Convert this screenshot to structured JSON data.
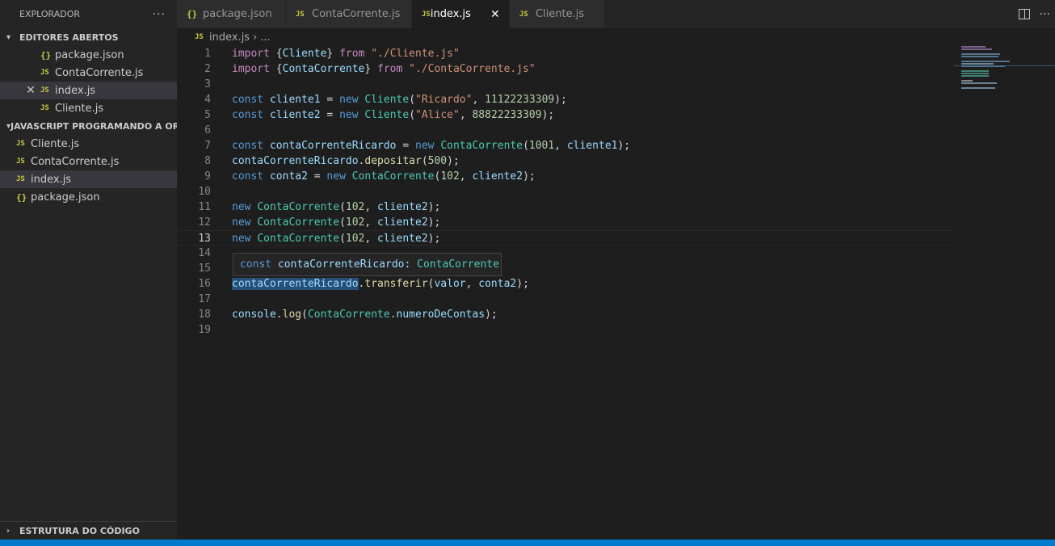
{
  "sidebar": {
    "title": "EXPLORADOR",
    "more": "···",
    "open_editors_title": "EDITORES ABERTOS",
    "open_editors": [
      {
        "icon": "{}",
        "label": "package.json"
      },
      {
        "icon": "JS",
        "label": "ContaCorrente.js"
      },
      {
        "icon": "JS",
        "label": "index.js",
        "close": "✕"
      },
      {
        "icon": "JS",
        "label": "Cliente.js"
      }
    ],
    "project_title": "JAVASCRIPT PROGRAMANDO A OR...",
    "files": [
      {
        "icon": "JS",
        "label": "Cliente.js"
      },
      {
        "icon": "JS",
        "label": "ContaCorrente.js"
      },
      {
        "icon": "JS",
        "label": "index.js"
      },
      {
        "icon": "{}",
        "label": "package.json"
      }
    ],
    "outline_title": "ESTRUTURA DO CÓDIGO"
  },
  "tabs": [
    {
      "icon": "{}",
      "label": "package.json"
    },
    {
      "icon": "JS",
      "label": "ContaCorrente.js"
    },
    {
      "icon": "JS",
      "label": "index.js",
      "close": "✕"
    },
    {
      "icon": "JS",
      "label": "Cliente.js"
    }
  ],
  "tab_actions": {
    "more": "···"
  },
  "breadcrumb": {
    "icon": "JS",
    "file": "index.js",
    "sep": "›",
    "rest": "..."
  },
  "editor": {
    "line_numbers": [
      "1",
      "2",
      "3",
      "4",
      "5",
      "6",
      "7",
      "8",
      "9",
      "10",
      "11",
      "12",
      "13",
      "14",
      "15",
      "16",
      "17",
      "18",
      "19"
    ],
    "current_line": 13
  },
  "hover": {
    "keyword": "const",
    "name": "contaCorrenteRicardo",
    "sep": ": ",
    "type": "ContaCorrente"
  },
  "colors": {
    "accent": "#007acc",
    "keyword": "#c586c0",
    "storage": "#569cd6",
    "class": "#4ec9b0",
    "variable": "#9cdcfe",
    "string": "#ce9178",
    "number": "#b5cea8",
    "function": "#dcdcaa"
  }
}
